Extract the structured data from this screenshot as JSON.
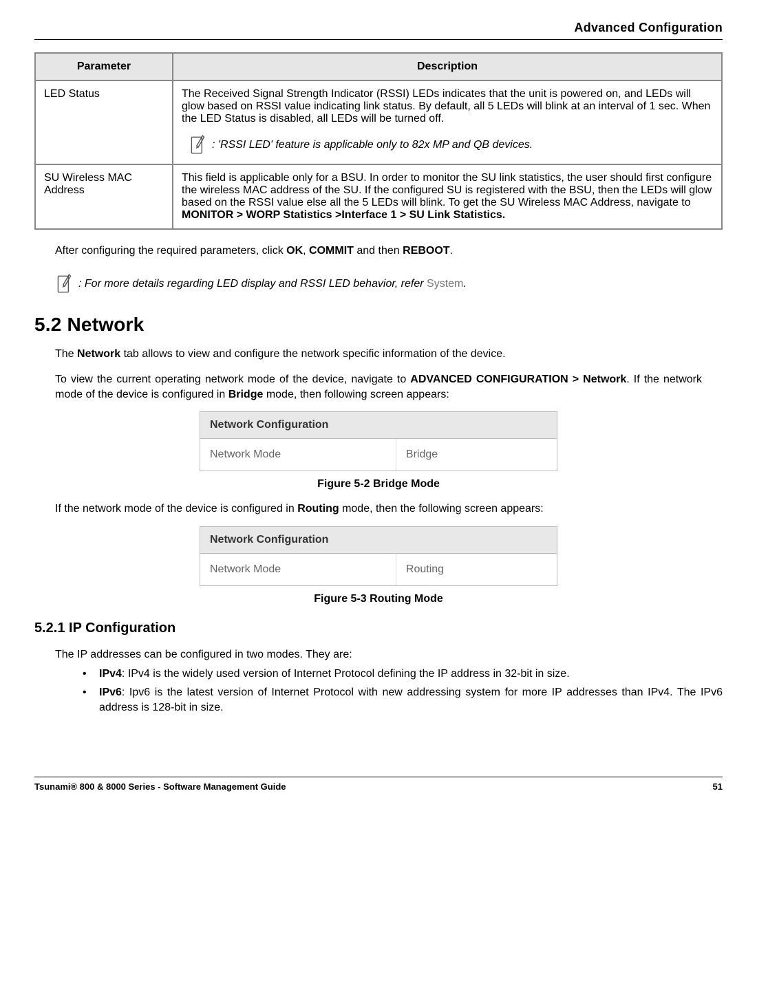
{
  "header": {
    "title": "Advanced Configuration"
  },
  "table": {
    "col1": "Parameter",
    "col2": "Description",
    "rows": [
      {
        "param": "LED Status",
        "desc": "The Received Signal Strength Indicator (RSSI) LEDs indicates that the unit is powered on, and LEDs will glow based on RSSI value indicating link status. By default, all 5 LEDs will blink at an interval of 1 sec. When the LED Status is disabled, all LEDs will be turned off.",
        "note": ": 'RSSI LED' feature is applicable only to 82x MP and QB devices."
      },
      {
        "param": "SU Wireless MAC Address",
        "desc_pre": "This field is applicable only for a BSU. In order to monitor the SU link statistics, the user should first configure the wireless MAC address of the SU. If the configured SU is registered with the BSU, then the LEDs will glow based on the RSSI value else all the 5 LEDs will blink. To get the SU Wireless MAC Address, navigate to ",
        "desc_bold": "MONITOR > WORP Statistics >Interface 1 > SU Link Statistics."
      }
    ]
  },
  "after_table": {
    "pre": "After configuring the required parameters, click ",
    "b1": "OK",
    "mid1": ", ",
    "b2": "COMMIT",
    "mid2": " and then ",
    "b3": "REBOOT",
    "post": "."
  },
  "page_note": {
    "pre": ": For more details regarding LED display and RSSI LED behavior, refer ",
    "link": "System",
    "post": "."
  },
  "s52": {
    "heading": "5.2 Network",
    "p1_pre": "The ",
    "p1_b": "Network",
    "p1_post": " tab allows to view and configure the network specific information of the device.",
    "p2_pre": "To view the current operating network mode of the device, navigate to ",
    "p2_b": "ADVANCED CONFIGURATION > Network",
    "p2_mid": ". If the network mode of the device is configured in ",
    "p2_b2": "Bridge",
    "p2_post": " mode, then following screen appears:"
  },
  "fig1": {
    "hd": "Network Configuration",
    "l": "Network Mode",
    "r": "Bridge",
    "cap": "Figure 5-2 Bridge Mode"
  },
  "mid_p": {
    "pre": "If the network mode of the device is configured in ",
    "b": "Routing",
    "post": " mode, then the following screen appears:"
  },
  "fig2": {
    "hd": "Network Configuration",
    "l": "Network Mode",
    "r": "Routing",
    "cap": "Figure 5-3 Routing Mode"
  },
  "s521": {
    "heading": "5.2.1 IP Configuration",
    "intro": "The IP addresses can be configured in two modes. They are:",
    "b1_b": "IPv4",
    "b1_t": ": IPv4 is the widely used version of Internet Protocol defining the IP address in 32-bit in size.",
    "b2_b": "IPv6",
    "b2_t": ": Ipv6 is the latest version of Internet Protocol with new addressing system for more IP addresses than IPv4. The IPv6 address is 128-bit in size."
  },
  "footer": {
    "left": "Tsunami® 800 & 8000 Series - Software Management Guide",
    "right": "51"
  }
}
